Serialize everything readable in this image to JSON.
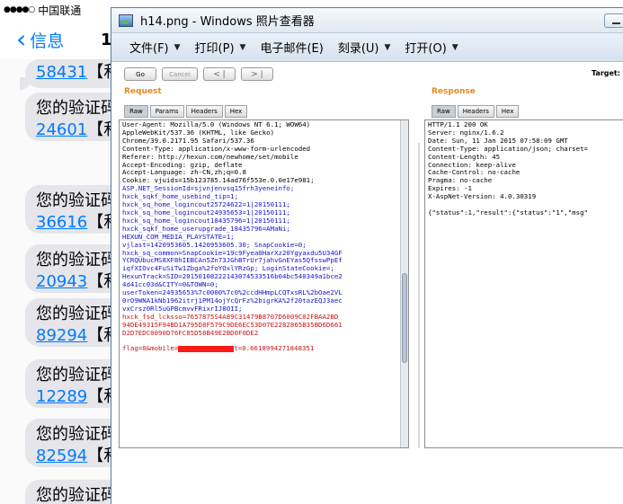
{
  "phone": {
    "status": {
      "signal": "●●●●○",
      "carrier": "中国联通"
    },
    "nav": {
      "back_label": "信息",
      "title_partial": "1"
    },
    "messages": [
      {
        "code": "58431",
        "suffix": "【和"
      },
      {
        "prefix": "您的验证码",
        "code": "24601",
        "suffix": "【和"
      },
      {
        "prefix": "您的验证码",
        "code": "36616",
        "suffix": "【和"
      },
      {
        "prefix": "您的验证码",
        "code": "20943",
        "suffix": "【和"
      },
      {
        "prefix": "您的验证码",
        "code": "89294",
        "suffix": "【和"
      },
      {
        "prefix": "您的验证码",
        "code": "12289",
        "suffix": "【和"
      },
      {
        "prefix": "您的验证码",
        "code": "82594",
        "suffix": "【和"
      },
      {
        "prefix": "您的验证码"
      }
    ]
  },
  "viewer": {
    "title": "h14.png - Windows 照片查看器",
    "menu": [
      {
        "label": "文件(F)"
      },
      {
        "label": "打印(P)"
      },
      {
        "label": "电子邮件(E)"
      },
      {
        "label": "刻录(U)"
      },
      {
        "label": "打开(O)"
      }
    ]
  },
  "burp": {
    "buttons": {
      "go": "Go",
      "cancel": "Cancel",
      "back": "< |",
      "forward": "> |"
    },
    "target_label": "Target: ht",
    "request": {
      "title": "Request",
      "tabs": [
        "Raw",
        "Params",
        "Headers",
        "Hex"
      ],
      "lines": [
        {
          "t": "User-Agent: Mozilla/5.0 (Windows NT 6.1; WOW64)",
          "c": "black"
        },
        {
          "t": "AppleWebKit/537.36 (KHTML, like Gecko)",
          "c": "black"
        },
        {
          "t": "Chrome/39.0.2171.95 Safari/537.36",
          "c": "black"
        },
        {
          "t": "Content-Type: application/x-www-form-urlencoded",
          "c": "black"
        },
        {
          "t": "Referer: http://hexun.com/newhome/set/mobile",
          "c": "black"
        },
        {
          "t": "Accept-Encoding: gzip, deflate",
          "c": "black"
        },
        {
          "t": "Accept-Language: zh-CN,zh;q=0.8",
          "c": "black"
        },
        {
          "t": "Cookie: vjuids=15b123785.14ad76f553e.0.0e17e981;",
          "c": "black"
        },
        {
          "t": "ASP.NET_SessionId=sjvnjenvsq15frh3yeneinfo;",
          "c": "blue"
        },
        {
          "t": "hxck_sqkf_home_usebind_tip=1;",
          "c": "blue"
        },
        {
          "t": "hxck_sq_home_logincout25724622=1|20150111;",
          "c": "blue"
        },
        {
          "t": "hxck_sq_home_logincout24935653=1|20150111;",
          "c": "blue"
        },
        {
          "t": "hxck_sq_home_logincout18435796=1|20150111;",
          "c": "blue"
        },
        {
          "t": "hxck_sqkf_home_userupgrade_18435796=AMaNi;",
          "c": "blue"
        },
        {
          "t": "HEXUN_COM_MEDIA_PLAYSTATE=1;",
          "c": "blue"
        },
        {
          "t": "vjlast=1420953605.1420953605.30; SnapCookie=0;",
          "c": "blue"
        },
        {
          "t": "hxck_sq_common=SnapCookie=19c9Fyea0HarXz20Ygyaxdu5U34GF",
          "c": "blue"
        },
        {
          "t": "YCRQUbucMS8XF8hIEBCAn5Zn73JGhBTrUr7jahvGnEYas5QfsswPpEf",
          "c": "blue"
        },
        {
          "t": "iqfXIOvc4FuSiTw1Zbga%2foYOxlYRzGp; LoginStateCookie=;",
          "c": "blue"
        },
        {
          "t": "HexunTrack=SID=20150108222143074533516b04bc540349a1bce2",
          "c": "blue"
        },
        {
          "t": "4d41cc03d&CITY=0&TOWN=0;",
          "c": "blue"
        },
        {
          "t": "userToken=24935653%7c0000%7c0%2ccdHHmpLCQTxsRL%2bOae2VL",
          "c": "blue"
        },
        {
          "t": "0rO9WNA1kNb1962itrj1PM14ojYcQrFz%2bigrKA%2f20tazEQJ3aec",
          "c": "blue"
        },
        {
          "t": "vxCrsz0Rl5uGPBcmvvFRixrIJ8OII;",
          "c": "blue"
        },
        {
          "t": "hxck_fsd_lcksso=7657875S4A89C31479B8707D6009C02FBAA2BD",
          "c": "red"
        },
        {
          "t": "94DE49315F94BD1A795D8F579C9DE6EC53D07E2282865B35BD6D661",
          "c": "red"
        },
        {
          "t": "D2D7EDC0090D76FC85D58B49E2BD0F0DE2",
          "c": "red"
        },
        {
          "t": "",
          "c": "black"
        },
        {
          "t": "flag=0&mobile=",
          "c": "red",
          "redacted": true,
          "tail": "t=0.6618994271848351"
        }
      ]
    },
    "response": {
      "title": "Response",
      "tabs": [
        "Raw",
        "Headers",
        "Hex"
      ],
      "lines": [
        {
          "t": "HTTP/1.1 200 OK",
          "c": "black"
        },
        {
          "t": "Server: nginx/1.6.2",
          "c": "black"
        },
        {
          "t": "Date: Sun, 11 Jan 2015 07:58:09 GMT",
          "c": "black"
        },
        {
          "t": "Content-Type: application/json; charset=",
          "c": "black"
        },
        {
          "t": "Content-Length: 45",
          "c": "black"
        },
        {
          "t": "Connection: keep-alive",
          "c": "black"
        },
        {
          "t": "Cache-Control: no-cache",
          "c": "black"
        },
        {
          "t": "Pragma: no-cache",
          "c": "black"
        },
        {
          "t": "Expires: -1",
          "c": "black"
        },
        {
          "t": "X-AspNet-Version: 4.0.30319",
          "c": "black"
        },
        {
          "t": "",
          "c": "black"
        },
        {
          "t": "{\"status\":1,\"result\":{\"status\":\"1\",\"msg\"",
          "c": "black"
        }
      ]
    }
  }
}
